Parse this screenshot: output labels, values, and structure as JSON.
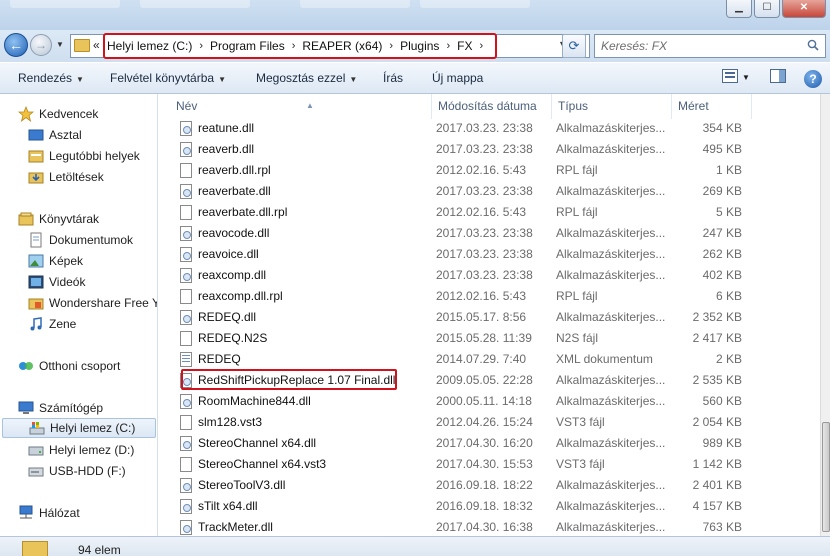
{
  "window": {
    "minimize_glyph": "▁",
    "maximize_glyph": "☐",
    "close_glyph": "✕"
  },
  "address_bar": {
    "overflow": "«",
    "crumbs": [
      "Helyi lemez (C:)",
      "Program Files",
      "REAPER (x64)",
      "Plugins",
      "FX"
    ],
    "separator": "›",
    "refresh_glyph": "⟳"
  },
  "search": {
    "placeholder": "Keresés: FX"
  },
  "toolbar": {
    "organize": "Rendezés",
    "add_to_library": "Felvétel könyvtárba",
    "share_with": "Megosztás ezzel",
    "burn": "Írás",
    "new_folder": "Új mappa",
    "help_glyph": "?"
  },
  "sidebar": {
    "favorites": "Kedvencek",
    "desktop": "Asztal",
    "recent": "Legutóbbi helyek",
    "downloads": "Letöltések",
    "libraries": "Könyvtárak",
    "documents": "Dokumentumok",
    "pictures": "Képek",
    "videos": "Videók",
    "wondershare": "Wondershare Free Y",
    "music": "Zene",
    "homegroup": "Otthoni csoport",
    "computer": "Számítógép",
    "drive_c": "Helyi lemez (C:)",
    "drive_d": "Helyi lemez (D:)",
    "usb": "USB-HDD (F:)",
    "network": "Hálózat"
  },
  "columns": {
    "name": "Név",
    "date": "Módosítás dátuma",
    "type": "Típus",
    "size": "Méret"
  },
  "files": [
    {
      "name": "reatune.dll",
      "date": "2017.03.23. 23:38",
      "type": "Alkalmazáskiterjes...",
      "size": "354 KB",
      "icon": "dll"
    },
    {
      "name": "reaverb.dll",
      "date": "2017.03.23. 23:38",
      "type": "Alkalmazáskiterjes...",
      "size": "495 KB",
      "icon": "dll"
    },
    {
      "name": "reaverb.dll.rpl",
      "date": "2012.02.16. 5:43",
      "type": "RPL fájl",
      "size": "1 KB",
      "icon": "file"
    },
    {
      "name": "reaverbate.dll",
      "date": "2017.03.23. 23:38",
      "type": "Alkalmazáskiterjes...",
      "size": "269 KB",
      "icon": "dll"
    },
    {
      "name": "reaverbate.dll.rpl",
      "date": "2012.02.16. 5:43",
      "type": "RPL fájl",
      "size": "5 KB",
      "icon": "file"
    },
    {
      "name": "reavocode.dll",
      "date": "2017.03.23. 23:38",
      "type": "Alkalmazáskiterjes...",
      "size": "247 KB",
      "icon": "dll"
    },
    {
      "name": "reavoice.dll",
      "date": "2017.03.23. 23:38",
      "type": "Alkalmazáskiterjes...",
      "size": "262 KB",
      "icon": "dll"
    },
    {
      "name": "reaxcomp.dll",
      "date": "2017.03.23. 23:38",
      "type": "Alkalmazáskiterjes...",
      "size": "402 KB",
      "icon": "dll"
    },
    {
      "name": "reaxcomp.dll.rpl",
      "date": "2012.02.16. 5:43",
      "type": "RPL fájl",
      "size": "6 KB",
      "icon": "file"
    },
    {
      "name": "REDEQ.dll",
      "date": "2015.05.17. 8:56",
      "type": "Alkalmazáskiterjes...",
      "size": "2 352 KB",
      "icon": "dll"
    },
    {
      "name": "REDEQ.N2S",
      "date": "2015.05.28. 11:39",
      "type": "N2S fájl",
      "size": "2 417 KB",
      "icon": "file"
    },
    {
      "name": "REDEQ",
      "date": "2014.07.29. 7:40",
      "type": "XML dokumentum",
      "size": "2 KB",
      "icon": "xml"
    },
    {
      "name": "RedShiftPickupReplace 1.07 Final.dll",
      "date": "2009.05.05. 22:28",
      "type": "Alkalmazáskiterjes...",
      "size": "2 535 KB",
      "icon": "dll"
    },
    {
      "name": "RoomMachine844.dll",
      "date": "2000.05.11. 14:18",
      "type": "Alkalmazáskiterjes...",
      "size": "560 KB",
      "icon": "dll"
    },
    {
      "name": "slm128.vst3",
      "date": "2012.04.26. 15:24",
      "type": "VST3 fájl",
      "size": "2 054 KB",
      "icon": "file"
    },
    {
      "name": "StereoChannel x64.dll",
      "date": "2017.04.30. 16:20",
      "type": "Alkalmazáskiterjes...",
      "size": "989 KB",
      "icon": "dll"
    },
    {
      "name": "StereoChannel x64.vst3",
      "date": "2017.04.30. 15:53",
      "type": "VST3 fájl",
      "size": "1 142 KB",
      "icon": "file"
    },
    {
      "name": "StereoToolV3.dll",
      "date": "2016.09.18. 18:22",
      "type": "Alkalmazáskiterjes...",
      "size": "2 401 KB",
      "icon": "dll"
    },
    {
      "name": "sTilt x64.dll",
      "date": "2016.09.18. 18:32",
      "type": "Alkalmazáskiterjes...",
      "size": "4 157 KB",
      "icon": "dll"
    },
    {
      "name": "TrackMeter.dll",
      "date": "2017.04.30. 16:38",
      "type": "Alkalmazáskiterjes...",
      "size": "763 KB",
      "icon": "dll"
    }
  ],
  "status": {
    "item_count": "94 elem"
  },
  "colors": {
    "highlight_red": "#d0121d",
    "selected_bg": "#dbe7f4",
    "header_text": "#4c607a"
  }
}
